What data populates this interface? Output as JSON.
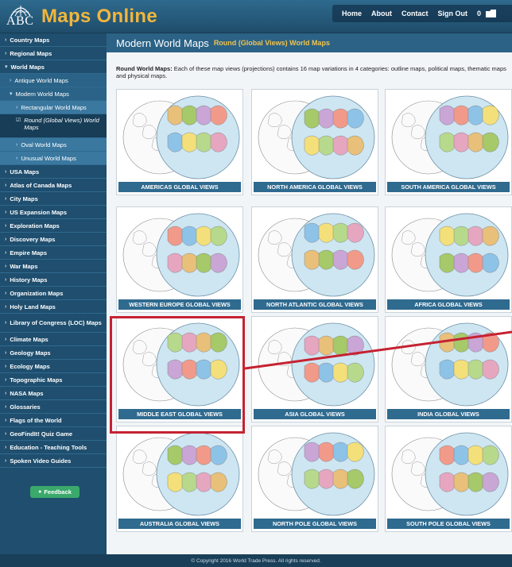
{
  "header": {
    "logo_abc": "ABC",
    "site_title": "Maps Online",
    "nav": [
      "Home",
      "About",
      "Contact",
      "Sign Out"
    ],
    "cart_count": "0"
  },
  "sidebar": {
    "items": [
      {
        "label": "Country Maps",
        "level": 0
      },
      {
        "label": "Regional Maps",
        "level": 0
      },
      {
        "label": "World Maps",
        "level": 0,
        "open": true
      },
      {
        "label": "Antique World Maps",
        "level": 1
      },
      {
        "label": "Modern World Maps",
        "level": 1,
        "open": true
      },
      {
        "label": "Rectangular World Maps",
        "level": 2
      },
      {
        "label": "Round (Global Views) World Maps",
        "level": 2,
        "active": true
      },
      {
        "label": "Oval World Maps",
        "level": 2
      },
      {
        "label": "Unusual World Maps",
        "level": 2
      },
      {
        "label": "USA Maps",
        "level": 0
      },
      {
        "label": "Atlas of Canada Maps",
        "level": 0
      },
      {
        "label": "City Maps",
        "level": 0
      },
      {
        "label": "US Expansion Maps",
        "level": 0
      },
      {
        "label": "Exploration Maps",
        "level": 0
      },
      {
        "label": "Discovery Maps",
        "level": 0
      },
      {
        "label": "Empire Maps",
        "level": 0
      },
      {
        "label": "War Maps",
        "level": 0
      },
      {
        "label": "History Maps",
        "level": 0
      },
      {
        "label": "Organization Maps",
        "level": 0
      },
      {
        "label": "Holy Land Maps",
        "level": 0
      },
      {
        "label": "Library of Congress (LOC) Maps",
        "level": 0,
        "tall": true
      },
      {
        "label": "Climate Maps",
        "level": 0
      },
      {
        "label": "Geology Maps",
        "level": 0
      },
      {
        "label": "Ecology Maps",
        "level": 0
      },
      {
        "label": "Topographic Maps",
        "level": 0
      },
      {
        "label": "NASA Maps",
        "level": 0
      },
      {
        "label": "Glossaries",
        "level": 0
      },
      {
        "label": "Flags of the World",
        "level": 0
      },
      {
        "label": "GeoFindIt! Quiz Game",
        "level": 0
      },
      {
        "label": "Education - Teaching Tools",
        "level": 0
      },
      {
        "label": "Spoken Video Guides",
        "level": 0
      }
    ],
    "feedback_label": "Feedback"
  },
  "main": {
    "title": "Modern World Maps",
    "subtitle": "Round (Global Views) World Maps",
    "intro_bold": "Round World Maps:",
    "intro_text": " Each of these map views (projections) contains 16 map variations in 4 categories: outline maps, political maps, thematic maps and physical maps.",
    "cards": [
      {
        "label": "AMERICAS GLOBAL VIEWS",
        "focus": "americas"
      },
      {
        "label": "NORTH AMERICA GLOBAL VIEWS",
        "focus": "north-america"
      },
      {
        "label": "SOUTH AMERICA GLOBAL VIEWS",
        "focus": "south-america"
      },
      {
        "label": "WESTERN EUROPE GLOBAL VIEWS",
        "focus": "europe"
      },
      {
        "label": "NORTH ATLANTIC GLOBAL VIEWS",
        "focus": "atlantic"
      },
      {
        "label": "AFRICA GLOBAL VIEWS",
        "focus": "africa"
      },
      {
        "label": "MIDDLE EAST GLOBAL VIEWS",
        "focus": "middle-east",
        "highlighted": true
      },
      {
        "label": "ASIA GLOBAL VIEWS",
        "focus": "asia"
      },
      {
        "label": "INDIA GLOBAL VIEWS",
        "focus": "india"
      },
      {
        "label": "AUSTRALIA GLOBAL VIEWS",
        "focus": "australia"
      },
      {
        "label": "NORTH POLE GLOBAL VIEWS",
        "focus": "north-pole"
      },
      {
        "label": "SOUTH POLE GLOBAL VIEWS",
        "focus": "south-pole"
      }
    ]
  },
  "footer": {
    "copyright": "© Copyright 2016 World Trade Press. All rights reserved."
  },
  "colors": {
    "accent_red": "#c52232",
    "brand_orange": "#f2b63c",
    "nav_blue": "#1f4e6e",
    "ocean": "#cde6f2",
    "land_colors": [
      "#e8c07a",
      "#a6c96a",
      "#c9a6d6",
      "#f29a8a",
      "#8ec3e8",
      "#f4e07a",
      "#b7d98c",
      "#e6a6c0"
    ]
  }
}
